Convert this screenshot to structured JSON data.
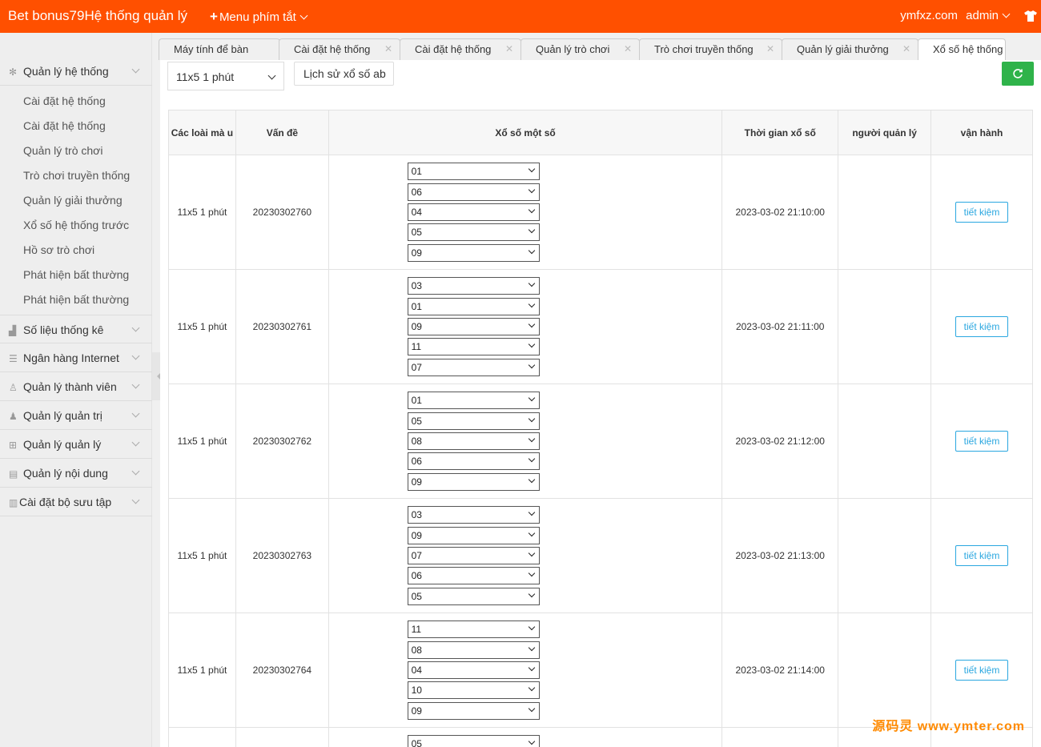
{
  "header": {
    "brand": "Bet bonus79Hệ thống quản lý",
    "shortcut_label": "Menu phím tắt",
    "domain": "ymfxz.com",
    "user": "admin"
  },
  "sidebar": {
    "groups": [
      {
        "label": "Quản lý hệ thống",
        "icon": "gear-icon"
      },
      {
        "label": "Số liệu thống kê",
        "icon": "chart-icon"
      },
      {
        "label": "Ngân hàng Internet",
        "icon": "list-icon"
      },
      {
        "label": "Quản lý thành viên",
        "icon": "user-outline-icon"
      },
      {
        "label": "Quản lý quản trị",
        "icon": "user-icon"
      },
      {
        "label": "Quản lý quản lý",
        "icon": "grid-icon"
      },
      {
        "label": "Quản lý nội dung",
        "icon": "document-icon"
      },
      {
        "label": "Cài đặt bộ sưu tập",
        "icon": "collection-icon"
      }
    ],
    "sub_items": [
      "Cài đặt hệ thống",
      "Cài đặt hệ thống",
      "Quản lý trò chơi",
      "Trò chơi truyền thống",
      "Quản lý giải thưởng",
      "Xổ số hệ thống trước",
      "Hồ sơ trò chơi",
      "Phát hiện bất thường",
      "Phát hiện bất thường"
    ]
  },
  "tabs": [
    {
      "label": "Máy tính để bàn"
    },
    {
      "label": "Cài đặt hệ thống"
    },
    {
      "label": "Cài đặt hệ thống"
    },
    {
      "label": "Quản lý trò chơi"
    },
    {
      "label": "Trò chơi truyền thống"
    },
    {
      "label": "Quản lý giải thưởng"
    },
    {
      "label": "Xổ số hệ thống"
    }
  ],
  "toolbar": {
    "game_select": "11x5 1 phút",
    "history_button": "Lịch sử xổ số ab"
  },
  "table": {
    "headers": [
      "Các loài mà u",
      "Vấn đề",
      "Xổ số một số",
      "Thời gian xổ số",
      "người quản lý",
      "vận hành"
    ],
    "save_label": "tiết kiệm",
    "rows": [
      {
        "type": "11x5 1 phút",
        "issue": "20230302760",
        "numbers": [
          "01",
          "06",
          "04",
          "05",
          "09"
        ],
        "time": "2023-03-02 21:10:00",
        "admin": ""
      },
      {
        "type": "11x5 1 phút",
        "issue": "20230302761",
        "numbers": [
          "03",
          "01",
          "09",
          "11",
          "07"
        ],
        "time": "2023-03-02 21:11:00",
        "admin": ""
      },
      {
        "type": "11x5 1 phút",
        "issue": "20230302762",
        "numbers": [
          "01",
          "05",
          "08",
          "06",
          "09"
        ],
        "time": "2023-03-02 21:12:00",
        "admin": ""
      },
      {
        "type": "11x5 1 phút",
        "issue": "20230302763",
        "numbers": [
          "03",
          "09",
          "07",
          "06",
          "05"
        ],
        "time": "2023-03-02 21:13:00",
        "admin": ""
      },
      {
        "type": "11x5 1 phút",
        "issue": "20230302764",
        "numbers": [
          "11",
          "08",
          "04",
          "10",
          "09"
        ],
        "time": "2023-03-02 21:14:00",
        "admin": ""
      }
    ],
    "partial_first_number": "05"
  },
  "watermark": "源码灵  www.ymter.com"
}
